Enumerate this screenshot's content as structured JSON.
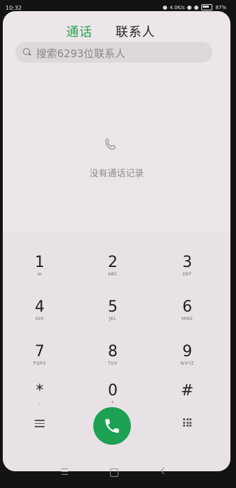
{
  "status_bar": {
    "time": "10:32",
    "network_speed": "4.0K/s",
    "battery": "87%"
  },
  "tabs": {
    "calls": "通话",
    "contacts": "联系人",
    "active": "calls"
  },
  "search": {
    "placeholder": "搜索6293位联系人"
  },
  "empty_state": {
    "text": "没有通话记录",
    "icon": "phone-outline-icon"
  },
  "keypad": {
    "keys": [
      {
        "num": "1",
        "sub": "ꝏ"
      },
      {
        "num": "2",
        "sub": "ABC"
      },
      {
        "num": "3",
        "sub": "DEF"
      },
      {
        "num": "4",
        "sub": "GHI"
      },
      {
        "num": "5",
        "sub": "JKL"
      },
      {
        "num": "6",
        "sub": "MNO"
      },
      {
        "num": "7",
        "sub": "PQRS"
      },
      {
        "num": "8",
        "sub": "TUV"
      },
      {
        "num": "9",
        "sub": "WXYZ"
      },
      {
        "num": "*",
        "sub": ","
      },
      {
        "num": "0",
        "sub": "+"
      },
      {
        "num": "#",
        "sub": ""
      }
    ]
  },
  "colors": {
    "accent": "#2aa552",
    "call_button": "#1da152"
  }
}
